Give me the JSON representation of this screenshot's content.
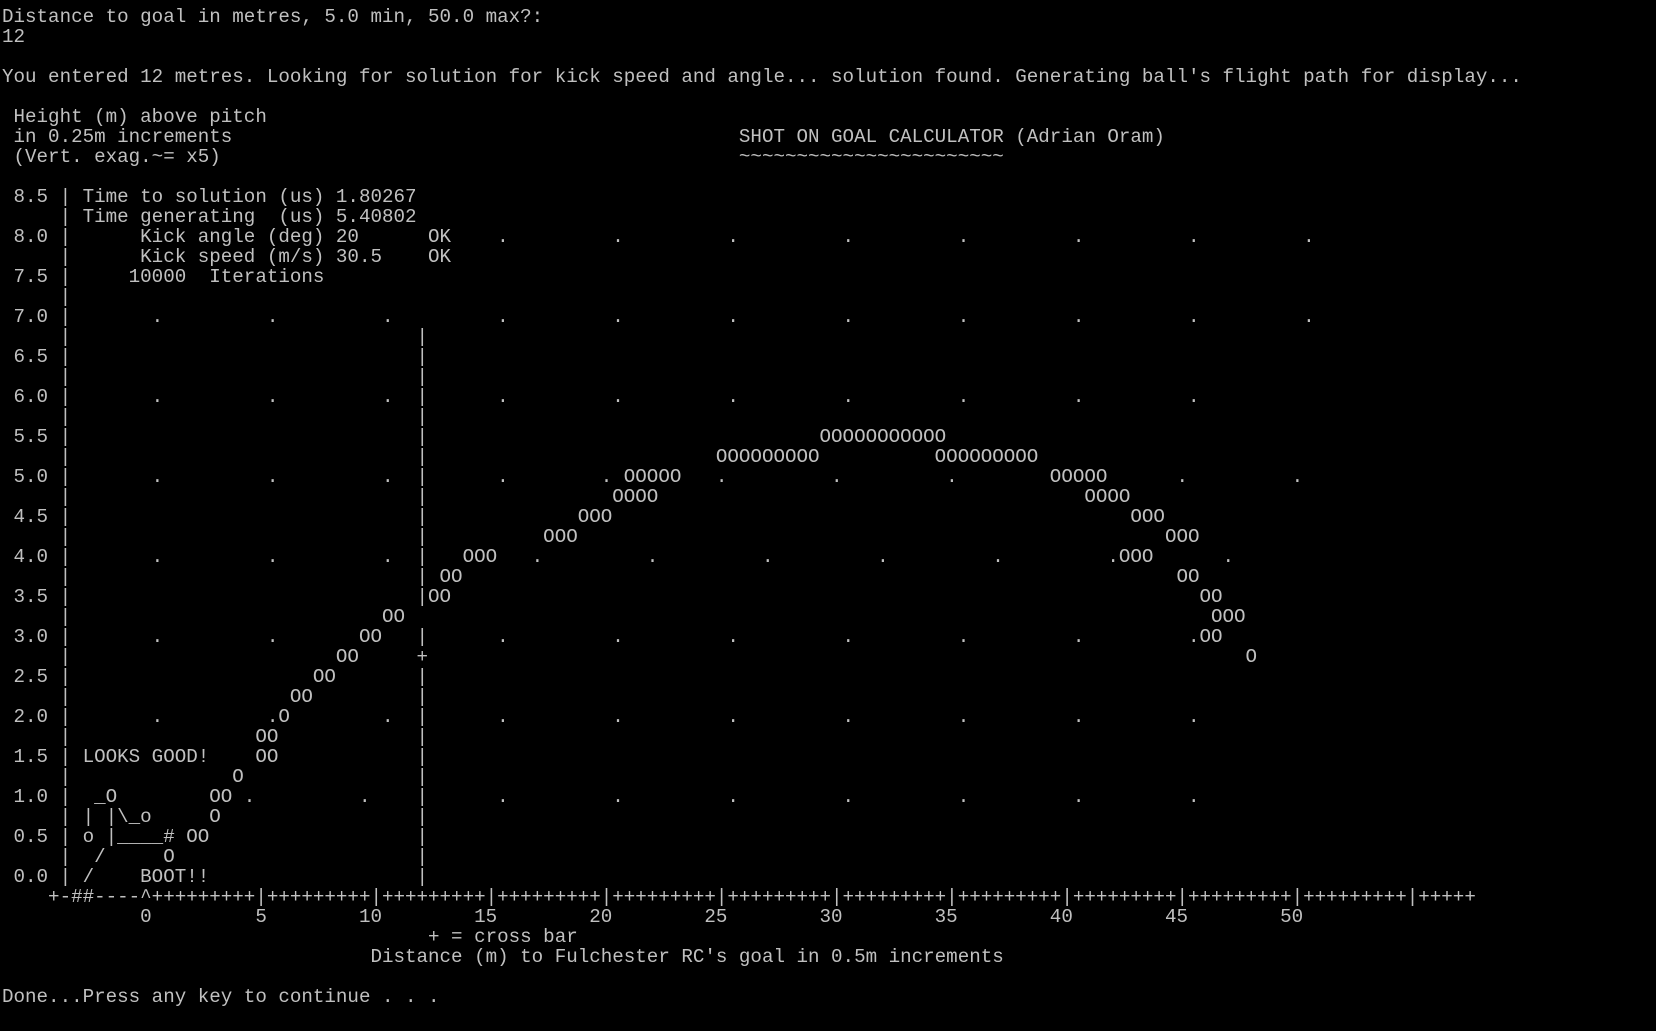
{
  "console": {
    "foreground": "#c0c0c0",
    "background": "#000000",
    "lines": [
      "Distance to goal in metres, 5.0 min, 50.0 max?:",
      "12",
      "",
      "You entered 12 metres. Looking for solution for kick speed and angle... solution found. Generating ball's flight path for display...",
      "",
      " Height (m) above pitch",
      " in 0.25m increments                                            SHOT ON GOAL CALCULATOR (Adrian Oram)",
      " (Vert. exag.~= x5)                                             ~~~~~~~~~~~~~~~~~~~~~~~",
      "",
      " 8.5 | Time to solution (us) 1.80267",
      "     | Time generating  (us) 5.40802",
      " 8.0 |      Kick angle (deg) 20      OK    .         .         .         .         .         .         .         .",
      "     |      Kick speed (m/s) 30.5    OK",
      " 7.5 |     10000  Iterations",
      "     |",
      " 7.0 |       .         .         .         .         .         .         .         .         .         .         .",
      "     |                              |",
      " 6.5 |                              |",
      "     |                              |",
      " 6.0 |       .         .         .  |      .         .         .         .         .         .         .",
      "     |                              |",
      " 5.5 |                              |                                  OOOOOOOOOOO",
      "     |                              |                         OOOOOOOOO          OOOOOOOOO",
      " 5.0 |       .         .         .  |      .        . OOOOO   .         .         .        OOOOO      .         .",
      "     |                              |                OOOO                                     OOOO",
      " 4.5 |                              |             OOO                                             OOO",
      "     |                              |          OOO                                                   OOO",
      " 4.0 |       .         .         .  |   OOO   .         .         .         .         .         .OOO      .",
      "     |                              | OO                                                              OO",
      " 3.5 |                              |OO                                                                 OO",
      "     |                           OO                                                                      OOO",
      " 3.0 |       .         .       OO   |      .         .         .         .         .         .         .OO",
      "     |                       OO     +                                                                       O",
      " 2.5 |                     OO       |",
      "     |                   OO         |",
      " 2.0 |       .         .O        .  |      .         .         .         .         .         .         .",
      "     |                OO            |",
      " 1.5 | LOOKS GOOD!    OO            |",
      "     |              O               |",
      " 1.0 |  _O        OO .         .    |      .         .         .         .         .         .         .",
      "     | | |\\_o     O                 |",
      " 0.5 | o |____# OO                  |",
      "     |  /     O                     |",
      " 0.0 | /    BOOT!!                  |",
      "    +-##----^+++++++++|+++++++++|+++++++++|+++++++++|+++++++++|+++++++++|+++++++++|+++++++++|+++++++++|+++++++++|+++++++++|+++++",
      "            0         5        10        15        20        25        30        35        40        45        50",
      "                                     + = cross bar",
      "                                Distance (m) to Fulchester RC's goal in 0.5m increments",
      "",
      "Done...Press any key to continue . . ."
    ]
  }
}
